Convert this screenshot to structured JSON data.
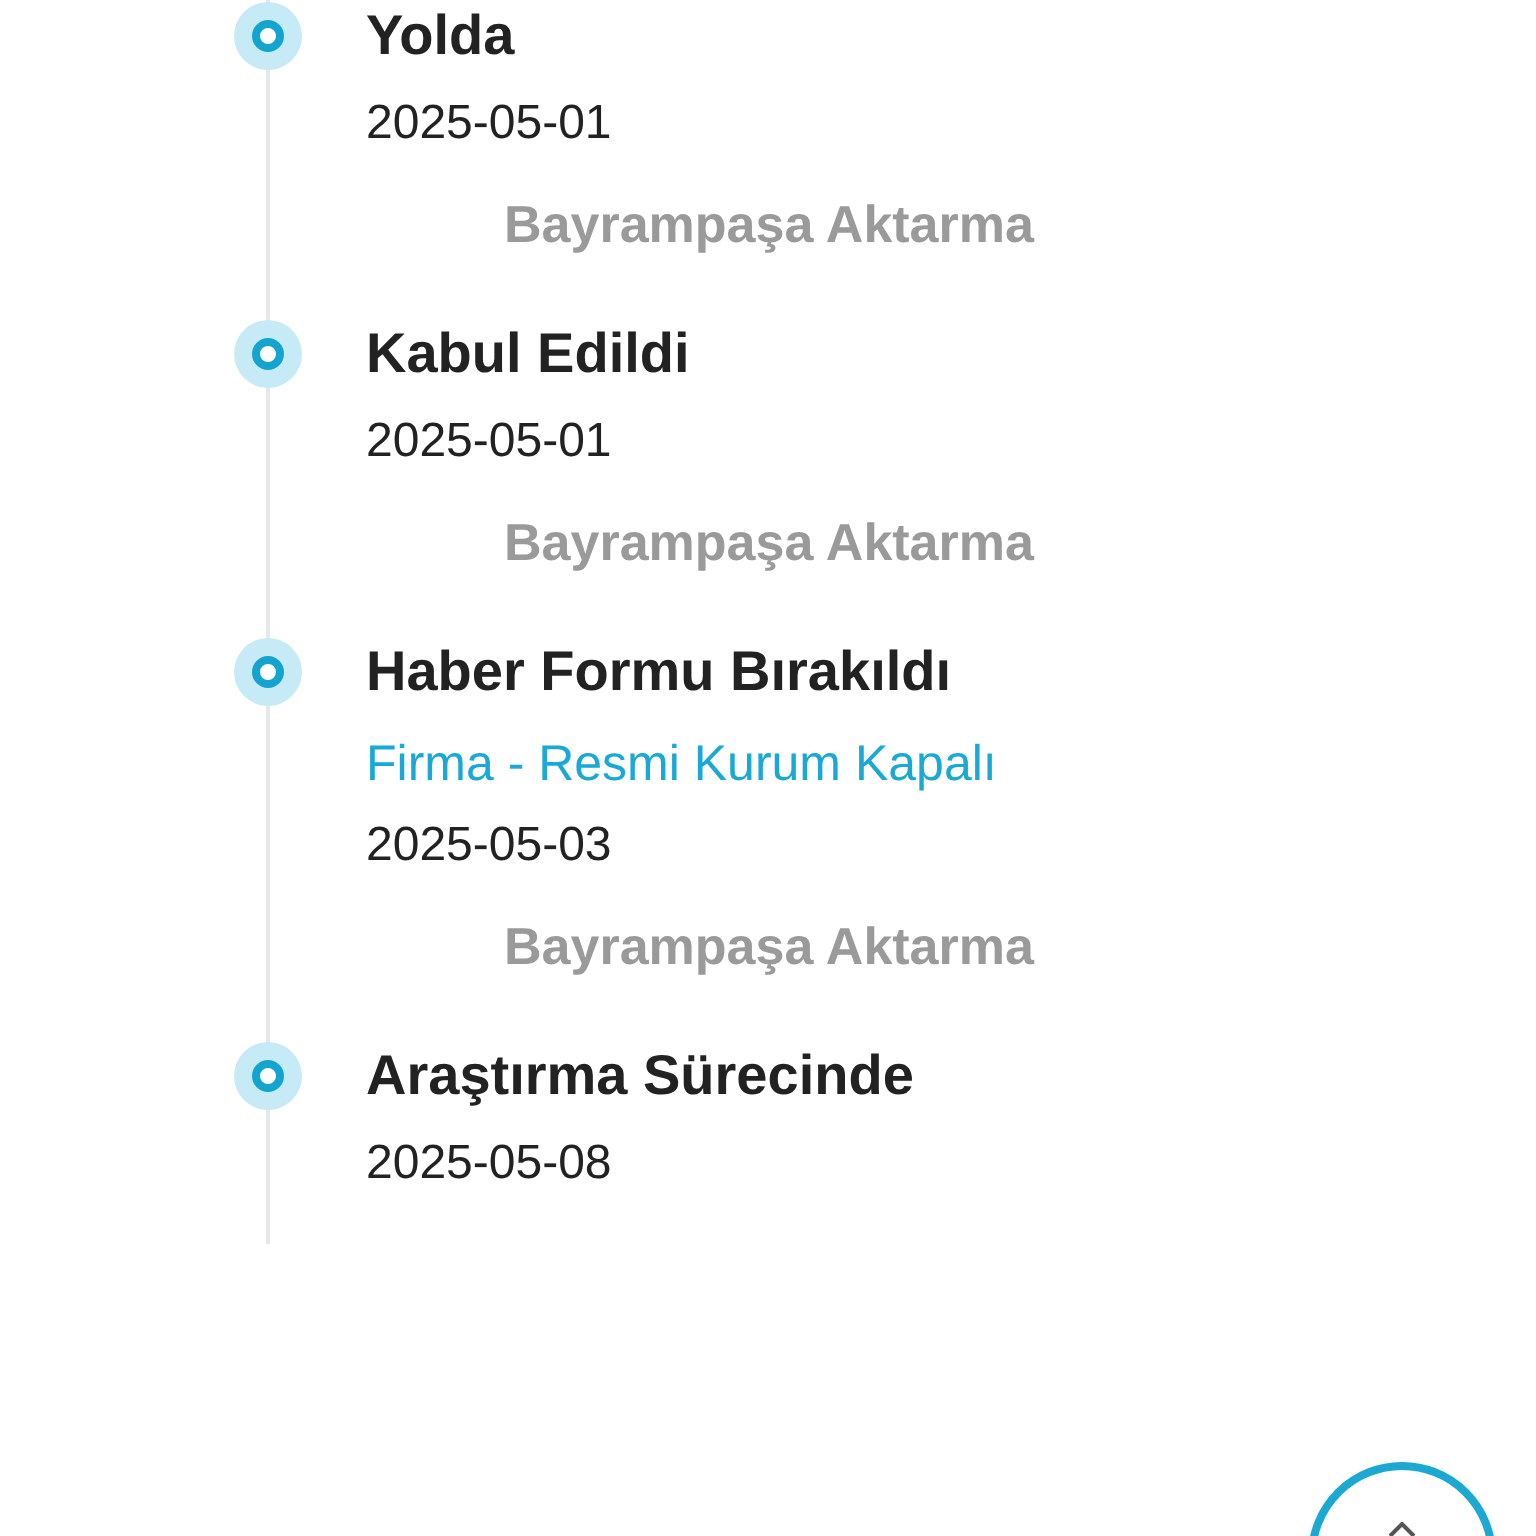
{
  "timeline": [
    {
      "title": "Yolda",
      "date": "2025-05-01",
      "location": "Bayrampaşa Aktarma"
    },
    {
      "title": "Kabul Edildi",
      "date": "2025-05-01",
      "location": "Bayrampaşa Aktarma"
    },
    {
      "title": "Haber Formu Bırakıldı",
      "note": "Firma - Resmi Kurum Kapalı",
      "date": "2025-05-03",
      "location": "Bayrampaşa Aktarma"
    },
    {
      "title": "Araştırma Sürecinde",
      "date": "2025-05-08"
    }
  ]
}
